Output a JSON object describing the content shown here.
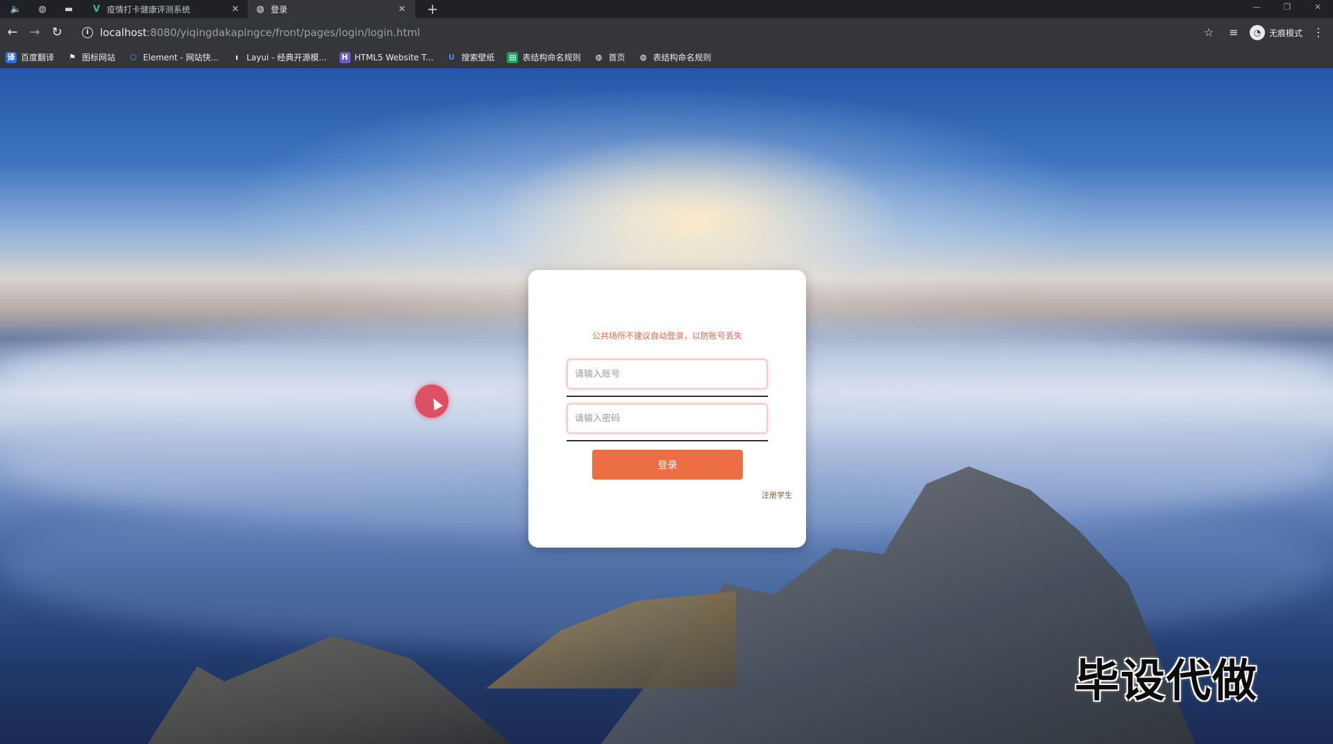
{
  "browser": {
    "tabs": [
      {
        "title": "疫情打卡健康评测系统",
        "favicon": "vue-icon"
      },
      {
        "title": "登录",
        "favicon": "globe-icon"
      }
    ],
    "url_host": "localhost",
    "url_path": ":8080/yiqingdakapingce/front/pages/login/login.html",
    "incognito_label": "无痕模式"
  },
  "bookmarks": [
    {
      "label": "百度翻译",
      "icon": "translate-icon",
      "color": "#2f6fe4"
    },
    {
      "label": "图标网站",
      "icon": "flag-icon",
      "color": "#202124"
    },
    {
      "label": "Element - 网站快...",
      "icon": "element-icon",
      "color": "#409eff"
    },
    {
      "label": "Layui - 经典开源模...",
      "icon": "layui-icon",
      "color": "#202124"
    },
    {
      "label": "HTML5 Website T...",
      "icon": "html5-icon",
      "color": "#6a5acd"
    },
    {
      "label": "搜索壁纸",
      "icon": "wallpaper-icon",
      "color": "#3b5bdb"
    },
    {
      "label": "表结构命名规则",
      "icon": "doc-icon",
      "color": "#1aa260"
    },
    {
      "label": "首页",
      "icon": "globe-icon",
      "color": "#202124"
    },
    {
      "label": "表结构命名规则",
      "icon": "globe-icon",
      "color": "#202124"
    }
  ],
  "login": {
    "notice": "公共场所不建议自动登录，以防账号丢失",
    "username_placeholder": "请输入账号",
    "password_placeholder": "请输入密码",
    "login_button": "登录",
    "register_link": "注册学生"
  },
  "overlay": {
    "watermark": "毕设代做"
  },
  "colors": {
    "accent": "#ed6d44",
    "notice": "#e0684f"
  }
}
